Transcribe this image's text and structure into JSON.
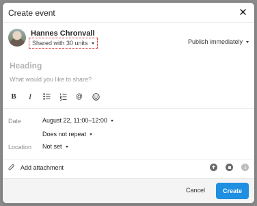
{
  "modal": {
    "title": "Create event",
    "close_label": "✕"
  },
  "author": {
    "name": "Hannes Chronvall",
    "shared_label": "Shared with 30 units"
  },
  "publish": {
    "label": "Publish immediately"
  },
  "composer": {
    "heading_placeholder": "Heading",
    "body_placeholder": "What would you like to share?",
    "toolbar": [
      "bold-icon",
      "italic-icon",
      "bulleted-list-icon",
      "numbered-list-icon",
      "mention-icon",
      "emoji-icon"
    ],
    "bold_glyph": "B",
    "italic_glyph": "I",
    "mention_glyph": "@"
  },
  "fields": {
    "date_label": "Date",
    "date_value": "August 22, 11:00–12:00",
    "repeat_value": "Does not repeat",
    "location_label": "Location",
    "location_value": "Not set"
  },
  "attachment": {
    "label": "Add attachment",
    "icons": [
      "upload-icon",
      "stop-icon",
      "info-icon"
    ]
  },
  "footer": {
    "cancel_label": "Cancel",
    "create_label": "Create"
  },
  "colors": {
    "primary": "#1e8fe1",
    "highlight_dash": "#dd3333",
    "backdrop": "#8a8a8a"
  }
}
